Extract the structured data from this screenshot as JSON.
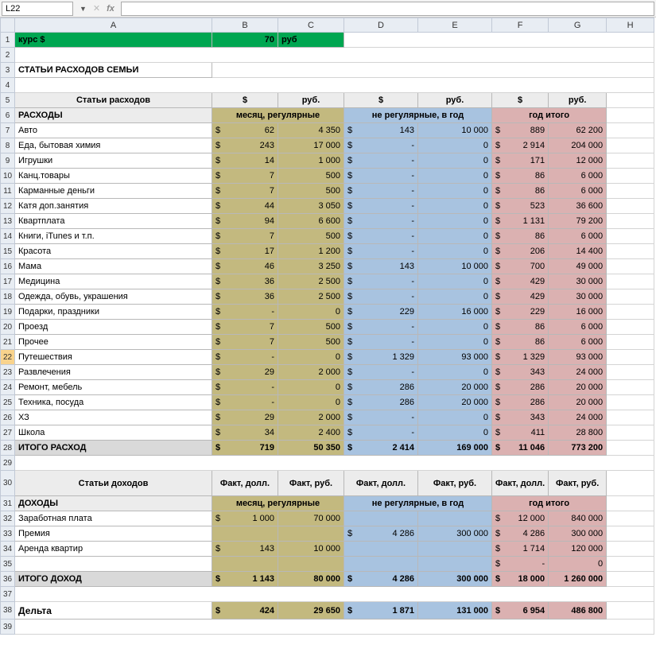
{
  "nameBox": "L22",
  "colHdrs": [
    "A",
    "B",
    "C",
    "D",
    "E",
    "F",
    "G",
    "H"
  ],
  "rows": [
    "1",
    "2",
    "3",
    "4",
    "5",
    "6",
    "7",
    "8",
    "9",
    "10",
    "11",
    "12",
    "13",
    "14",
    "15",
    "16",
    "17",
    "18",
    "19",
    "20",
    "21",
    "22",
    "23",
    "24",
    "25",
    "26",
    "27",
    "28",
    "29",
    "30",
    "31",
    "32",
    "33",
    "34",
    "35",
    "36",
    "37",
    "38",
    "39"
  ],
  "r1": {
    "A": "курс $",
    "B": "70",
    "C": "руб"
  },
  "r3": {
    "A": "СТАТЬИ РАСХОДОВ СЕМЬИ"
  },
  "r5": {
    "A": "Статьи расходов",
    "B": "$",
    "C": "руб.",
    "D": "$",
    "E": "руб.",
    "F": "$",
    "G": "руб."
  },
  "r6": {
    "A": "РАСХОДЫ",
    "BC": "месяц, регулярные",
    "DE": "не регулярные, в год",
    "FG": "год итого"
  },
  "exp": [
    {
      "n": "Авто",
      "mu": "62",
      "mr": "4 350",
      "iu": "143",
      "ir": "10 000",
      "yu": "889",
      "yr": "62 200"
    },
    {
      "n": "Еда, бытовая химия",
      "mu": "243",
      "mr": "17 000",
      "iu": "-",
      "ir": "0",
      "yu": "2 914",
      "yr": "204 000"
    },
    {
      "n": "Игрушки",
      "mu": "14",
      "mr": "1 000",
      "iu": "-",
      "ir": "0",
      "yu": "171",
      "yr": "12 000"
    },
    {
      "n": "Канц.товары",
      "mu": "7",
      "mr": "500",
      "iu": "-",
      "ir": "0",
      "yu": "86",
      "yr": "6 000"
    },
    {
      "n": "Карманные деньги",
      "mu": "7",
      "mr": "500",
      "iu": "-",
      "ir": "0",
      "yu": "86",
      "yr": "6 000"
    },
    {
      "n": "Катя доп.занятия",
      "mu": "44",
      "mr": "3 050",
      "iu": "-",
      "ir": "0",
      "yu": "523",
      "yr": "36 600"
    },
    {
      "n": "Квартплата",
      "mu": "94",
      "mr": "6 600",
      "iu": "-",
      "ir": "0",
      "yu": "1 131",
      "yr": "79 200"
    },
    {
      "n": "Книги, iTunes и т.п.",
      "mu": "7",
      "mr": "500",
      "iu": "-",
      "ir": "0",
      "yu": "86",
      "yr": "6 000"
    },
    {
      "n": "Красота",
      "mu": "17",
      "mr": "1 200",
      "iu": "-",
      "ir": "0",
      "yu": "206",
      "yr": "14 400"
    },
    {
      "n": "Мама",
      "mu": "46",
      "mr": "3 250",
      "iu": "143",
      "ir": "10 000",
      "yu": "700",
      "yr": "49 000"
    },
    {
      "n": "Медицина",
      "mu": "36",
      "mr": "2 500",
      "iu": "-",
      "ir": "0",
      "yu": "429",
      "yr": "30 000"
    },
    {
      "n": "Одежда, обувь, украшения",
      "mu": "36",
      "mr": "2 500",
      "iu": "-",
      "ir": "0",
      "yu": "429",
      "yr": "30 000"
    },
    {
      "n": "Подарки, праздники",
      "mu": "-",
      "mr": "0",
      "iu": "229",
      "ir": "16 000",
      "yu": "229",
      "yr": "16 000"
    },
    {
      "n": "Проезд",
      "mu": "7",
      "mr": "500",
      "iu": "-",
      "ir": "0",
      "yu": "86",
      "yr": "6 000"
    },
    {
      "n": "Прочее",
      "mu": "7",
      "mr": "500",
      "iu": "-",
      "ir": "0",
      "yu": "86",
      "yr": "6 000"
    },
    {
      "n": "Путешествия",
      "mu": "-",
      "mr": "0",
      "iu": "1 329",
      "ir": "93 000",
      "yu": "1 329",
      "yr": "93 000"
    },
    {
      "n": "Развлечения",
      "mu": "29",
      "mr": "2 000",
      "iu": "-",
      "ir": "0",
      "yu": "343",
      "yr": "24 000"
    },
    {
      "n": "Ремонт, мебель",
      "mu": "-",
      "mr": "0",
      "iu": "286",
      "ir": "20 000",
      "yu": "286",
      "yr": "20 000"
    },
    {
      "n": "Техника, посуда",
      "mu": "-",
      "mr": "0",
      "iu": "286",
      "ir": "20 000",
      "yu": "286",
      "yr": "20 000"
    },
    {
      "n": "ХЗ",
      "mu": "29",
      "mr": "2 000",
      "iu": "-",
      "ir": "0",
      "yu": "343",
      "yr": "24 000"
    },
    {
      "n": "Школа",
      "mu": "34",
      "mr": "2 400",
      "iu": "-",
      "ir": "0",
      "yu": "411",
      "yr": "28 800"
    }
  ],
  "expTotal": {
    "n": "ИТОГО РАСХОД",
    "mu": "719",
    "mr": "50 350",
    "iu": "2 414",
    "ir": "169 000",
    "yu": "11 046",
    "yr": "773 200"
  },
  "r30": {
    "A": "Статьи доходов",
    "B": "Факт, долл.",
    "C": "Факт, руб.",
    "D": "Факт, долл.",
    "E": "Факт, руб.",
    "F": "Факт, долл.",
    "G": "Факт, руб."
  },
  "r31": {
    "A": "ДОХОДЫ",
    "BC": "месяц, регулярные",
    "DE": "не регулярные, в год",
    "FG": "год итого"
  },
  "inc": [
    {
      "n": "Заработная плата",
      "mu": "1 000",
      "mr": "70 000",
      "iu": "",
      "ir": "",
      "yu": "12 000",
      "yr": "840 000"
    },
    {
      "n": "Премия",
      "mu": "",
      "mr": "",
      "iu": "4 286",
      "ir": "300 000",
      "yu": "4 286",
      "yr": "300 000"
    },
    {
      "n": "Аренда квартир",
      "mu": "143",
      "mr": "10 000",
      "iu": "",
      "ir": "",
      "yu": "1 714",
      "yr": "120 000"
    },
    {
      "n": "",
      "mu": "",
      "mr": "",
      "iu": "",
      "ir": "",
      "yu": "-",
      "yr": "0"
    }
  ],
  "incTotal": {
    "n": "ИТОГО ДОХОД",
    "mu": "1 143",
    "mr": "80 000",
    "iu": "4 286",
    "ir": "300 000",
    "yu": "18 000",
    "yr": "1 260 000"
  },
  "delta": {
    "n": "Дельта",
    "mu": "424",
    "mr": "29 650",
    "iu": "1 871",
    "ir": "131 000",
    "yu": "6 954",
    "yr": "486 800"
  }
}
